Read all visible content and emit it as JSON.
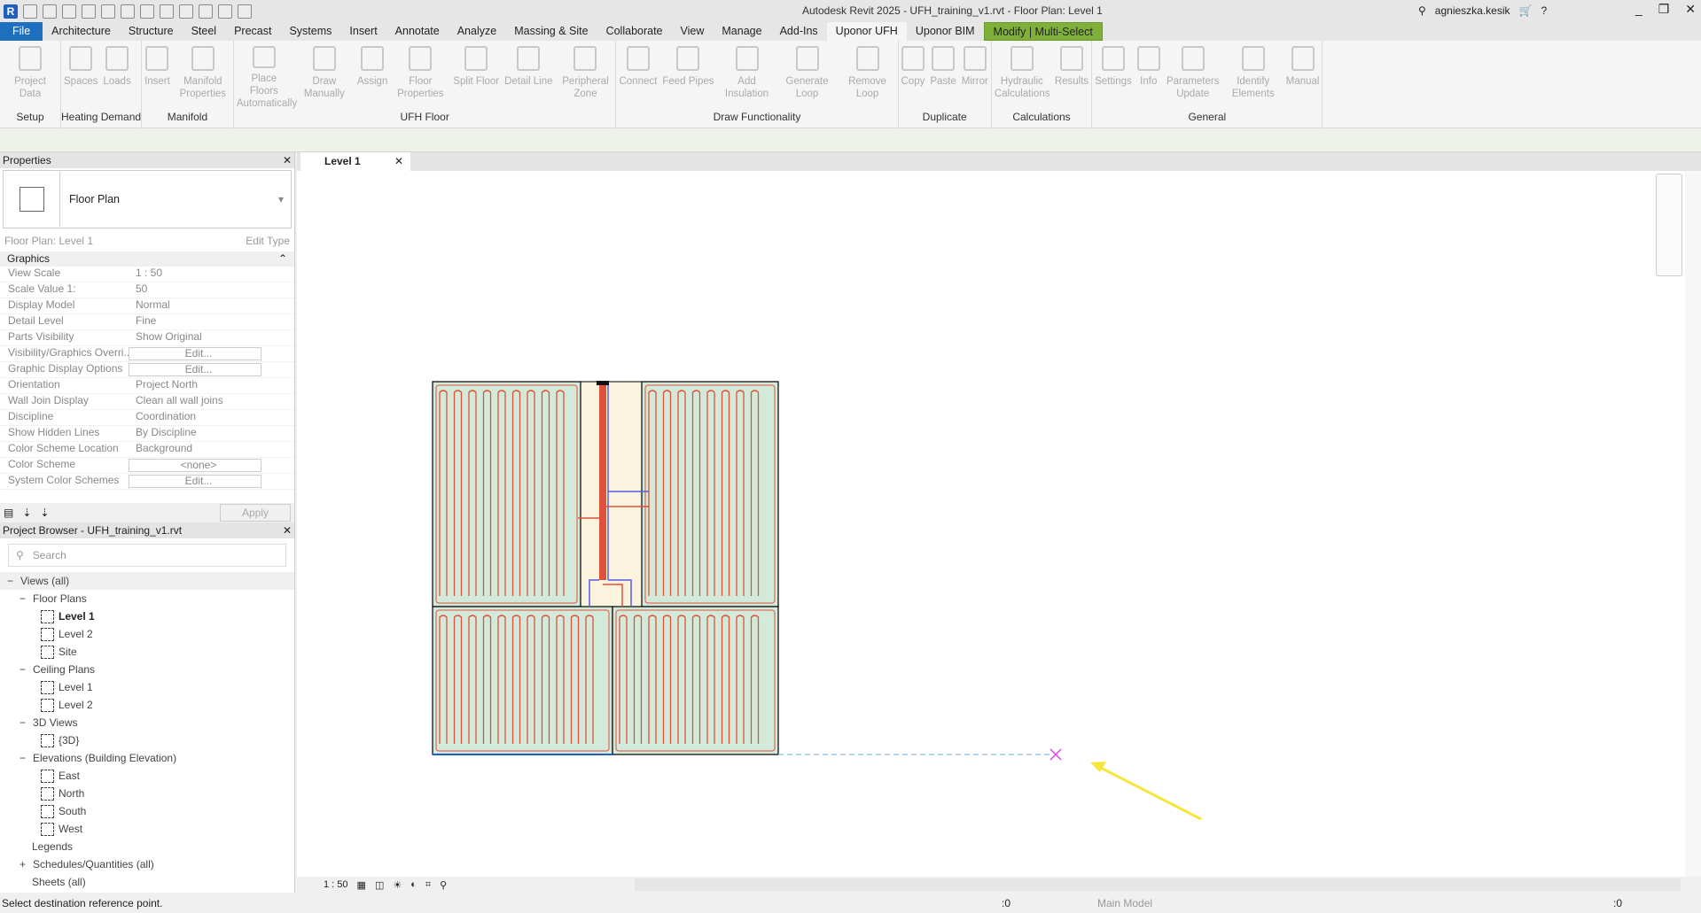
{
  "app": {
    "title": "Autodesk Revit 2025 - UFH_training_v1.rvt - Floor Plan: Level 1",
    "user": "agnieszka.kesik",
    "logo": "R"
  },
  "tabs": [
    "File",
    "Architecture",
    "Structure",
    "Steel",
    "Precast",
    "Systems",
    "Insert",
    "Annotate",
    "Analyze",
    "Massing & Site",
    "Collaborate",
    "View",
    "Manage",
    "Add-Ins",
    "Uponor UFH",
    "Uponor BIM",
    "Modify | Multi-Select"
  ],
  "active_tab": "Uponor UFH",
  "ribbon": [
    {
      "label": "Setup",
      "buttons": [
        "Project Data"
      ]
    },
    {
      "label": "Heating Demand",
      "buttons": [
        "Spaces",
        "Loads"
      ]
    },
    {
      "label": "Manifold",
      "buttons": [
        "Insert",
        "Manifold Properties"
      ]
    },
    {
      "label": "UFH Floor",
      "buttons": [
        "Place Floors Automatically",
        "Draw Manually",
        "Assign",
        "Floor Properties",
        "Split Floor",
        "Detail Line",
        "Peripheral Zone"
      ]
    },
    {
      "label": "Draw Functionality",
      "buttons": [
        "Connect",
        "Feed Pipes",
        "Add Insulation",
        "Generate Loop",
        "Remove Loop"
      ]
    },
    {
      "label": "Duplicate",
      "buttons": [
        "Copy",
        "Paste",
        "Mirror"
      ]
    },
    {
      "label": "Calculations",
      "buttons": [
        "Hydraulic Calculations",
        "Results"
      ]
    },
    {
      "label": "General",
      "buttons": [
        "Settings",
        "Info",
        "Parameters Update",
        "Identify Elements",
        "Manual"
      ]
    }
  ],
  "properties": {
    "title": "Properties",
    "type": "Floor Plan",
    "instance": "Floor Plan: Level 1",
    "edit_type": "Edit Type",
    "group": "Graphics",
    "apply": "Apply",
    "rows": [
      {
        "k": "View Scale",
        "v": "1 : 50"
      },
      {
        "k": "Scale Value    1:",
        "v": "50"
      },
      {
        "k": "Display Model",
        "v": "Normal"
      },
      {
        "k": "Detail Level",
        "v": "Fine"
      },
      {
        "k": "Parts Visibility",
        "v": "Show Original"
      },
      {
        "k": "Visibility/Graphics Overri...",
        "v": "Edit...",
        "btn": true
      },
      {
        "k": "Graphic Display Options",
        "v": "Edit...",
        "btn": true
      },
      {
        "k": "Orientation",
        "v": "Project North"
      },
      {
        "k": "Wall Join Display",
        "v": "Clean all wall joins"
      },
      {
        "k": "Discipline",
        "v": "Coordination"
      },
      {
        "k": "Show Hidden Lines",
        "v": "By Discipline"
      },
      {
        "k": "Color Scheme Location",
        "v": "Background"
      },
      {
        "k": "Color Scheme",
        "v": "<none>",
        "btn": true
      },
      {
        "k": "System Color Schemes",
        "v": "Edit...",
        "btn": true
      }
    ]
  },
  "browser": {
    "title": "Project Browser - UFH_training_v1.rvt",
    "search_placeholder": "Search",
    "items": [
      {
        "t": "Views (all)",
        "d": 0,
        "sel": true,
        "exp": "−"
      },
      {
        "t": "Floor Plans",
        "d": 1,
        "exp": "−"
      },
      {
        "t": "Level 1",
        "d": 2,
        "view": true,
        "bold": true
      },
      {
        "t": "Level 2",
        "d": 2,
        "view": true
      },
      {
        "t": "Site",
        "d": 2,
        "view": true
      },
      {
        "t": "Ceiling Plans",
        "d": 1,
        "exp": "−"
      },
      {
        "t": "Level 1",
        "d": 2,
        "view": true
      },
      {
        "t": "Level 2",
        "d": 2,
        "view": true
      },
      {
        "t": "3D Views",
        "d": 1,
        "exp": "−"
      },
      {
        "t": "{3D}",
        "d": 2,
        "view": true
      },
      {
        "t": "Elevations (Building Elevation)",
        "d": 1,
        "exp": "−"
      },
      {
        "t": "East",
        "d": 2,
        "view": true
      },
      {
        "t": "North",
        "d": 2,
        "view": true
      },
      {
        "t": "South",
        "d": 2,
        "view": true
      },
      {
        "t": "West",
        "d": 2,
        "view": true
      },
      {
        "t": "Legends",
        "d": 1
      },
      {
        "t": "Schedules/Quantities (all)",
        "d": 1,
        "exp": "+"
      },
      {
        "t": "Sheets (all)",
        "d": 1
      }
    ]
  },
  "view_tab": "Level 1",
  "view_control": {
    "scale": "1 : 50"
  },
  "status": {
    "message": "Select destination reference point.",
    "model": "Main Model",
    "worksets": ":0",
    "filter": ":0"
  },
  "colors": {
    "floor_fill": "#d3eadb",
    "corridor_fill": "#faf4df",
    "supply_pipe": "#e0503a",
    "return_pipe": "#5a5ae0",
    "arrow": "#f5e63a",
    "marker": "#e040e0",
    "modify_tab": "#7fb13a",
    "file_tab": "#1e6fbd"
  }
}
